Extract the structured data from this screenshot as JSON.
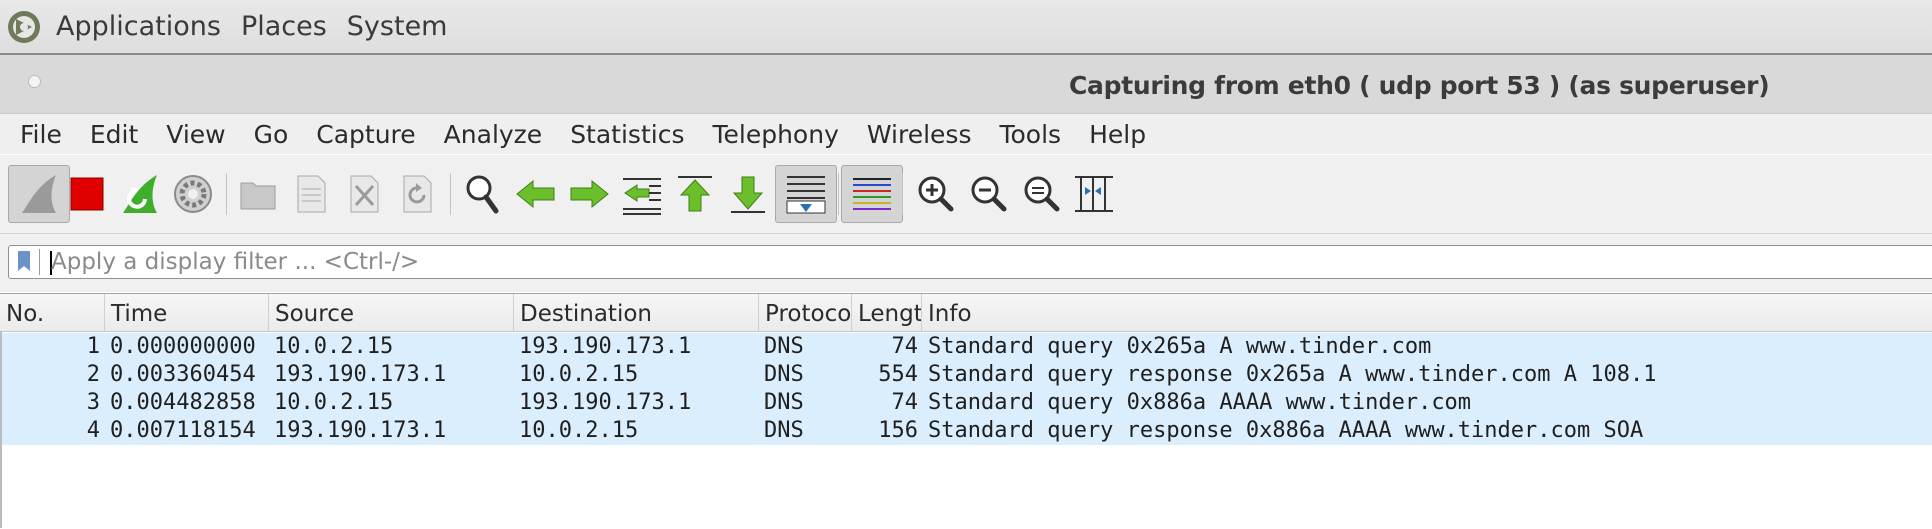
{
  "desktop_panel": {
    "items": [
      "Applications",
      "Places",
      "System"
    ]
  },
  "window": {
    "title": "Capturing from eth0 ( udp port 53 ) (as superuser)"
  },
  "menu": {
    "items": [
      "File",
      "Edit",
      "View",
      "Go",
      "Capture",
      "Analyze",
      "Statistics",
      "Telephony",
      "Wireless",
      "Tools",
      "Help"
    ]
  },
  "toolbar": {
    "buttons": [
      "shark-fin-icon",
      "stop-capture-icon",
      "restart-capture-icon",
      "capture-options-icon",
      "open-file-icon",
      "save-file-icon",
      "close-file-icon",
      "reload-file-icon",
      "find-packet-icon",
      "go-back-icon",
      "go-forward-icon",
      "go-to-packet-icon",
      "first-packet-icon",
      "last-packet-icon",
      "autoscroll-icon",
      "colorize-icon",
      "zoom-in-icon",
      "zoom-out-icon",
      "normal-size-icon",
      "resize-columns-icon"
    ]
  },
  "filter": {
    "placeholder": "Apply a display filter ... <Ctrl-/>",
    "value": ""
  },
  "packet_list": {
    "columns": [
      "No.",
      "Time",
      "Source",
      "Destination",
      "Protocol",
      "Length",
      "Info"
    ],
    "rows": [
      {
        "no": "1",
        "time": "0.000000000",
        "source": "10.0.2.15",
        "destination": "193.190.173.1",
        "protocol": "DNS",
        "length": "74",
        "info": "Standard query 0x265a A www.tinder.com"
      },
      {
        "no": "2",
        "time": "0.003360454",
        "source": "193.190.173.1",
        "destination": "10.0.2.15",
        "protocol": "DNS",
        "length": "554",
        "info": "Standard query response 0x265a A www.tinder.com A 108.1"
      },
      {
        "no": "3",
        "time": "0.004482858",
        "source": "10.0.2.15",
        "destination": "193.190.173.1",
        "protocol": "DNS",
        "length": "74",
        "info": "Standard query 0x886a AAAA www.tinder.com"
      },
      {
        "no": "4",
        "time": "0.007118154",
        "source": "193.190.173.1",
        "destination": "10.0.2.15",
        "protocol": "DNS",
        "length": "156",
        "info": "Standard query response 0x886a AAAA www.tinder.com SOA"
      }
    ]
  },
  "colors": {
    "row_highlight": "#daeefd",
    "stop_red": "#e00000",
    "arrow_green": "#6bbf2a"
  }
}
